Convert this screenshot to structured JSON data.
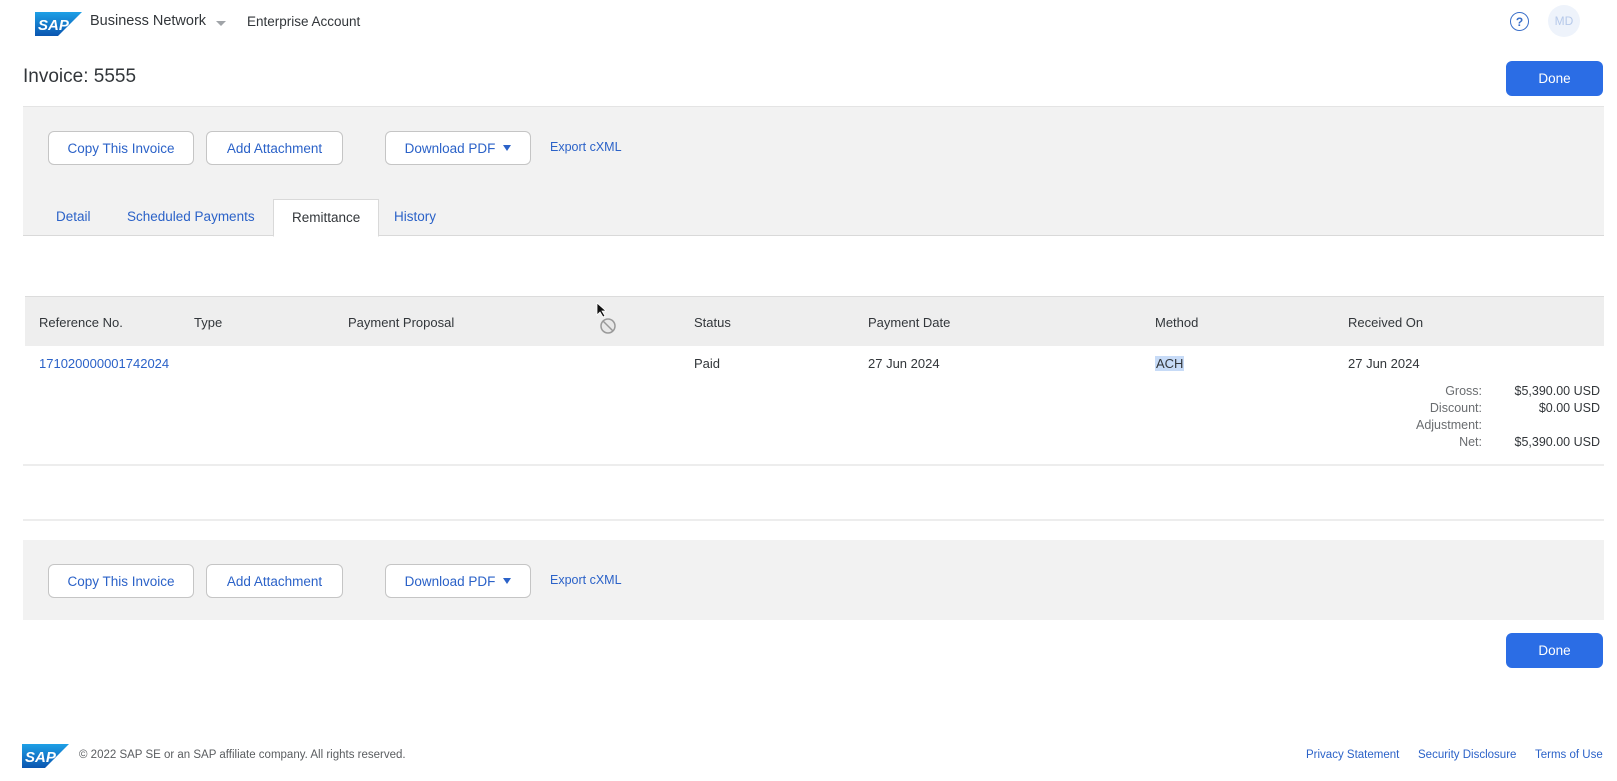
{
  "header": {
    "logo": "SAP",
    "brand": "Business Network",
    "account": "Enterprise Account",
    "help_icon": "?",
    "avatar_initials": "MD"
  },
  "page": {
    "title": "Invoice: 5555",
    "done_label": "Done"
  },
  "toolbar": {
    "copy_label": "Copy This Invoice",
    "attach_label": "Add Attachment",
    "pdf_label": "Download PDF",
    "export_label": "Export cXML"
  },
  "tabs": [
    {
      "label": "Detail",
      "active": false
    },
    {
      "label": "Scheduled Payments",
      "active": false
    },
    {
      "label": "Remittance",
      "active": true
    },
    {
      "label": "History",
      "active": false
    }
  ],
  "table": {
    "columns": [
      "Reference No.",
      "Type",
      "Payment Proposal",
      "Status",
      "Payment Date",
      "Method",
      "Received On"
    ],
    "rows": [
      {
        "reference": "171020000001742024",
        "type": "",
        "proposal": "",
        "status": "Paid",
        "payment_date": "27 Jun 2024",
        "method": "ACH",
        "received_on": "27 Jun 2024",
        "totals": {
          "gross_label": "Gross:",
          "gross": "$5,390.00 USD",
          "discount_label": "Discount:",
          "discount": "$0.00 USD",
          "adjustment_label": "Adjustment:",
          "adjustment": "",
          "net_label": "Net:",
          "net": "$5,390.00 USD"
        }
      }
    ]
  },
  "footer": {
    "logo": "SAP",
    "copyright": "© 2022 SAP SE or an SAP affiliate company. All rights reserved.",
    "links": [
      "Privacy Statement",
      "Security Disclosure",
      "Terms of Use"
    ]
  },
  "colors": {
    "primary": "#2b6de5",
    "link": "#2b62c8",
    "toolbar_bg": "#f2f2f2",
    "selection": "#c7dbf7"
  }
}
